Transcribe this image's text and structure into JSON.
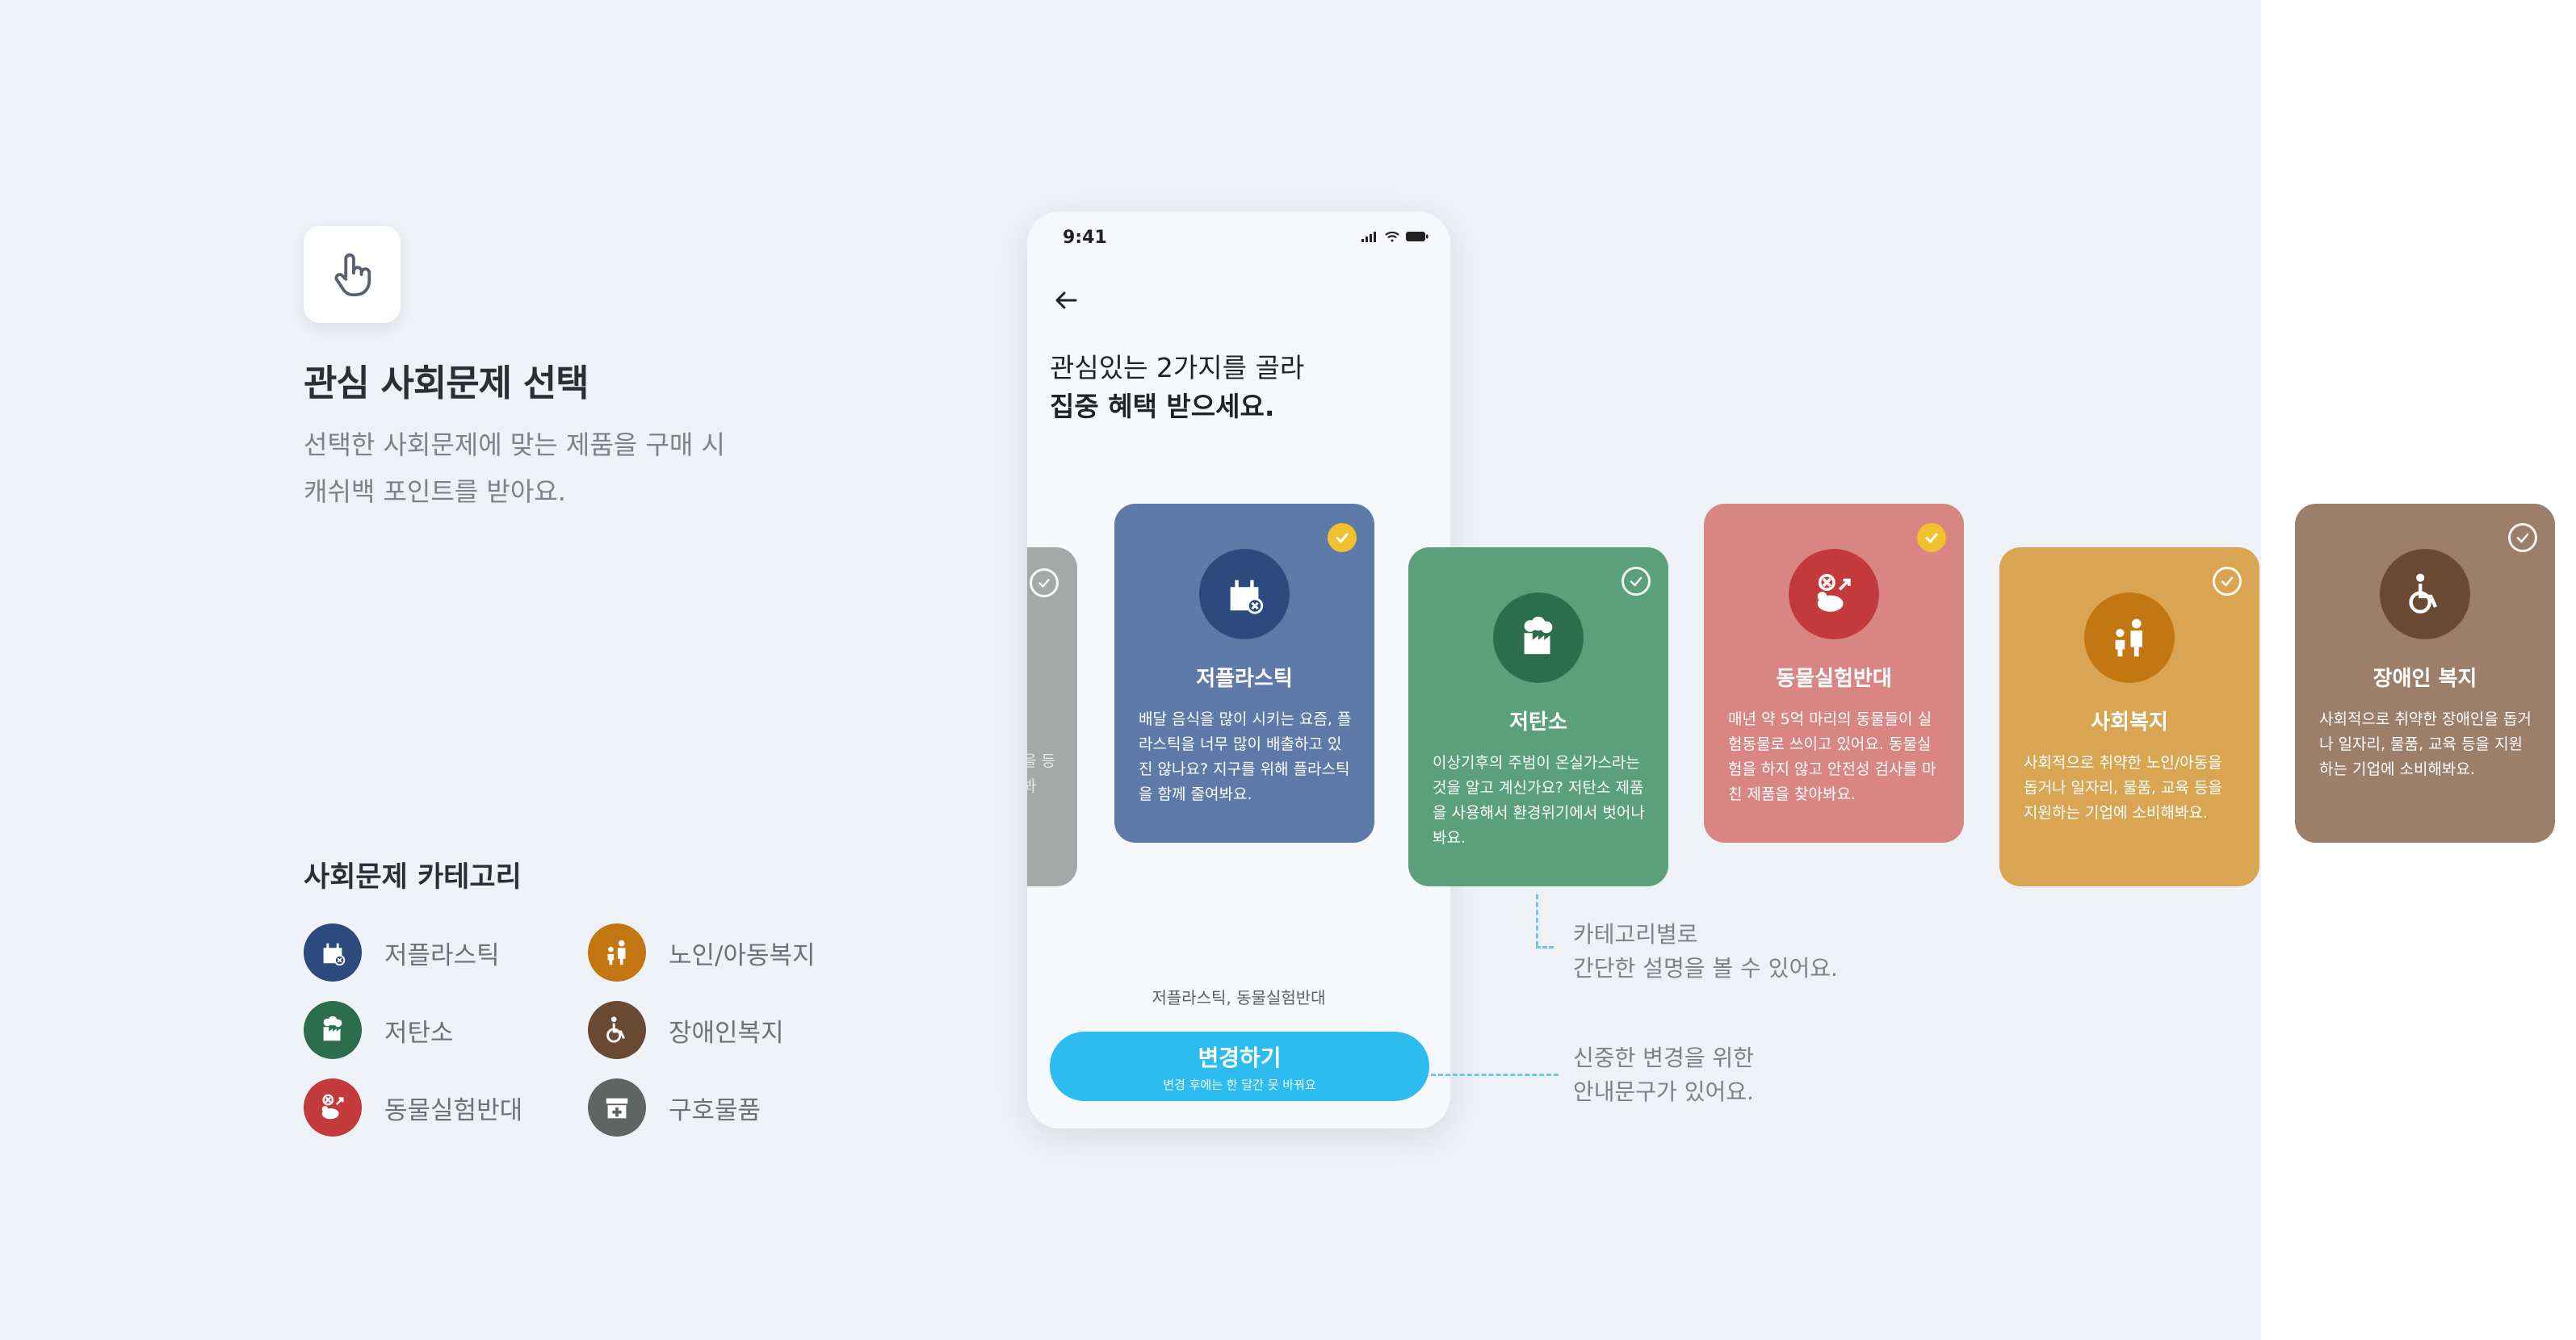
{
  "intro": {
    "icon": "pointer-hand-icon",
    "title": "관심 사회문제 선택",
    "desc_line1": "선택한 사회문제에 맞는 제품을 구매 시",
    "desc_line2": "캐쉬백 포인트를 받아요."
  },
  "categories": {
    "title": "사회문제 카테고리",
    "items": [
      {
        "label": "저플라스틱",
        "icon": "plastic-bag-icon",
        "color": "#2c4a7d"
      },
      {
        "label": "노인/아동복지",
        "icon": "family-icon",
        "color": "#c27712"
      },
      {
        "label": "저탄소",
        "icon": "factory-icon",
        "color": "#2b6e4c"
      },
      {
        "label": "장애인복지",
        "icon": "wheelchair-icon",
        "color": "#6b4a34"
      },
      {
        "label": "동물실험반대",
        "icon": "mouse-icon",
        "color": "#c33a3c"
      },
      {
        "label": "구호물품",
        "icon": "relief-box-icon",
        "color": "#5e6563"
      }
    ]
  },
  "phone": {
    "time": "9:41",
    "headline_line1": "관심있는 2가지를 골라",
    "headline_line2": "집중 혜택 받으세요.",
    "selected_text": "저플라스틱, 동물실험반대",
    "button_label": "변경하기",
    "button_sub": "변경 후에는 한 달간 못 바꿔요"
  },
  "cards": [
    {
      "title": "저플라스틱",
      "desc": "배달 음식을 많이 시키는 요즘, 플라스틱을 너무 많이 배출하고 있진 않나요? 지구를 위해 플라스틱을 함께 줄여봐요.",
      "selected": true,
      "color": "#5d7aa8",
      "icon_color": "#2c4a7d",
      "icon": "plastic-bag-icon"
    },
    {
      "title": "저탄소",
      "desc": "이상기후의 주범이 온실가스라는 것을 알고 계신가요? 저탄소 제품을 사용해서 환경위기에서 벗어나봐요.",
      "selected": false,
      "color": "#5aa07a",
      "icon_color": "#2b6e4c",
      "icon": "factory-icon"
    },
    {
      "title": "동물실험반대",
      "desc": "매년 약 5억 마리의 동물들이 실험동물로 쓰이고 있어요. 동물실험을 하지 않고 안전성 검사를 마친 제품을 찾아봐요.",
      "selected": true,
      "color": "#d88584",
      "icon_color": "#c33a3c",
      "icon": "mouse-icon"
    },
    {
      "title": "사회복지",
      "desc": "사회적으로 취약한 노인/아동을 돕거나 일자리, 물품, 교육 등을 지원하는 기업에 소비해봐요.",
      "selected": false,
      "color": "#d9a552",
      "icon_color": "#c27712",
      "icon": "family-icon"
    },
    {
      "title": "장애인 복지",
      "desc": "사회적으로 취약한 장애인을 돕거나 일자리, 물품, 교육 등을 지원하는 기업에 소비해봐요.",
      "selected": false,
      "color": "#9c7f6b",
      "icon_color": "#6b4a34",
      "icon": "wheelchair-icon"
    }
  ],
  "ghost_card": {
    "text": "을 등 봐"
  },
  "annotations": {
    "card_line1": "카테고리별로",
    "card_line2": "간단한 설명을 볼 수 있어요.",
    "button_line1": "신중한 변경을 위한",
    "button_line2": "안내문구가 있어요."
  }
}
